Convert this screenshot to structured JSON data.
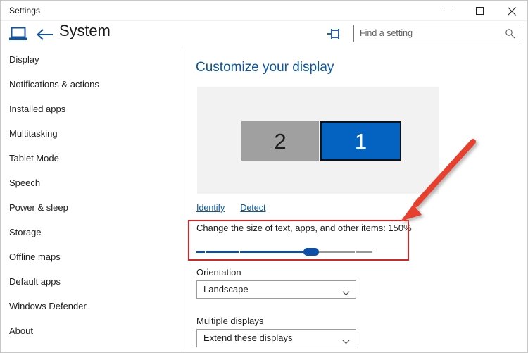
{
  "window": {
    "title": "Settings",
    "controls": [
      {
        "name": "minimize",
        "glyph": "minimize-icon"
      },
      {
        "name": "maximize",
        "glyph": "maximize-icon"
      },
      {
        "name": "close",
        "glyph": "close-icon"
      }
    ]
  },
  "header": {
    "home_icon": "laptop-icon",
    "back_label": "back-arrow-icon",
    "title": "System",
    "pin_icon": "pin-icon",
    "search": {
      "placeholder": "Find a setting",
      "value": "",
      "icon": "search-icon"
    }
  },
  "sidebar": {
    "items": [
      {
        "label": "Display"
      },
      {
        "label": "Notifications & actions"
      },
      {
        "label": "Installed apps"
      },
      {
        "label": "Multitasking"
      },
      {
        "label": "Tablet Mode"
      },
      {
        "label": "Speech"
      },
      {
        "label": "Power & sleep"
      },
      {
        "label": "Storage"
      },
      {
        "label": "Offline maps"
      },
      {
        "label": "Default apps"
      },
      {
        "label": "Windows Defender"
      },
      {
        "label": "About"
      }
    ]
  },
  "main": {
    "page_title": "Customize your display",
    "monitors": [
      {
        "label": "2",
        "selected": false
      },
      {
        "label": "1",
        "selected": true
      }
    ],
    "links": [
      {
        "label": "Identify"
      },
      {
        "label": "Detect"
      }
    ],
    "scale": {
      "label": "Change the size of text, apps, and other items: 150%",
      "value": "150%",
      "slider_percent": 65
    },
    "orientation": {
      "label": "Orientation",
      "value": "Landscape",
      "chevron": "chevron-down-icon"
    },
    "multiple_displays": {
      "label": "Multiple displays",
      "value": "Extend these displays",
      "chevron": "chevron-down-icon"
    }
  },
  "annotations": {
    "highlight_rect_color": "#e02020",
    "arrow_color": "#e8412f",
    "arrow_target": "scale-label"
  }
}
